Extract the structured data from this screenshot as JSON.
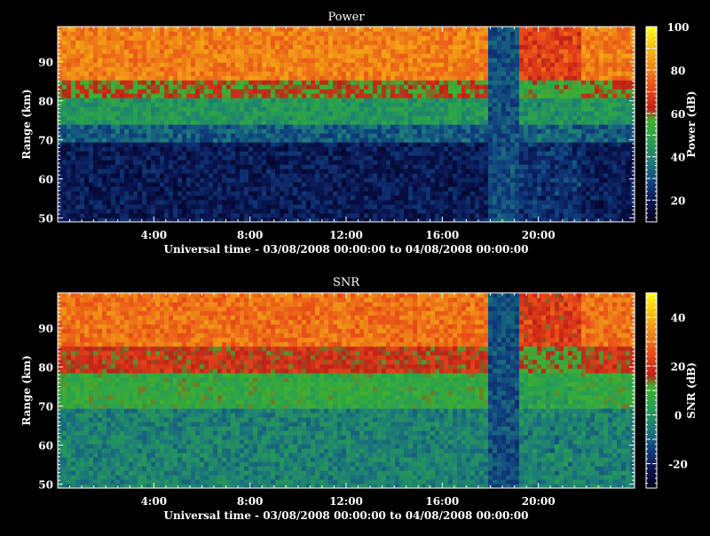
{
  "chart_data": [
    {
      "type": "heatmap",
      "title": "Power",
      "xlabel": "Universal time - 03/08/2008 00:00:00 to 04/08/2008 00:00:00",
      "ylabel": "Range (km)",
      "x_ticks": [
        "4:00",
        "8:00",
        "12:00",
        "16:00",
        "20:00"
      ],
      "y_ticks": [
        "50",
        "60",
        "70",
        "80",
        "90"
      ],
      "xlim_hours": [
        0,
        24
      ],
      "ylim_km": [
        49,
        99
      ],
      "colorbar": {
        "label": "Power (dB)",
        "ticks": [
          "20",
          "40",
          "60",
          "80",
          "100"
        ],
        "range": [
          10,
          100
        ]
      },
      "profile": [
        {
          "range_km": [
            85,
            99
          ],
          "value_db": 80
        },
        {
          "range_km": [
            81,
            85
          ],
          "value_db": 60
        },
        {
          "range_km": [
            74,
            81
          ],
          "value_db": 45
        },
        {
          "range_km": [
            69,
            74
          ],
          "value_db": 32
        },
        {
          "range_km": [
            49,
            69
          ],
          "value_db": 20
        }
      ],
      "gap_hours": [
        17.9,
        19.2
      ]
    },
    {
      "type": "heatmap",
      "title": "SNR",
      "xlabel": "Universal time - 03/08/2008 00:00:00 to 04/08/2008 00:00:00",
      "ylabel": "Range (km)",
      "x_ticks": [
        "4:00",
        "8:00",
        "12:00",
        "16:00",
        "20:00"
      ],
      "y_ticks": [
        "50",
        "60",
        "70",
        "80",
        "90"
      ],
      "xlim_hours": [
        0,
        24
      ],
      "ylim_km": [
        49,
        99
      ],
      "colorbar": {
        "label": "SNR (dB)",
        "ticks": [
          "-20",
          "0",
          "20",
          "40"
        ],
        "range": [
          -30,
          50
        ]
      },
      "profile": [
        {
          "range_km": [
            85,
            99
          ],
          "value_db": 30
        },
        {
          "range_km": [
            79,
            85
          ],
          "value_db": 18
        },
        {
          "range_km": [
            70,
            79
          ],
          "value_db": 8
        },
        {
          "range_km": [
            49,
            70
          ],
          "value_db": -4
        }
      ],
      "gap_hours": [
        17.9,
        19.2
      ]
    }
  ]
}
